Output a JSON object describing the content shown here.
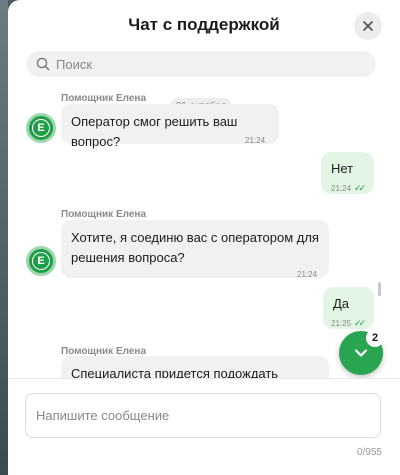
{
  "header": {
    "title": "Чат с поддержкой",
    "close_icon": "close-icon"
  },
  "search": {
    "placeholder": "Поиск",
    "icon": "search-icon"
  },
  "chat": {
    "date_label": "31 октября",
    "messages": [
      {
        "direction": "in",
        "sender": "Помощник Елена",
        "avatar": "Е",
        "lines": [
          "Оператор смог решить ваш вопрос?"
        ],
        "time": "21:24"
      },
      {
        "direction": "out",
        "lines": [
          "Нет"
        ],
        "time": "21:24",
        "status": "read"
      },
      {
        "direction": "in",
        "sender": "Помощник Елена",
        "avatar": "Е",
        "lines": [
          "Хотите, я соединю вас с оператором для",
          "решения вопроса?"
        ],
        "time": "21:24"
      },
      {
        "direction": "out",
        "lines": [
          "Да"
        ],
        "time": "21:25",
        "status": "read"
      },
      {
        "direction": "in",
        "sender": "Помощник Елена",
        "lines": [
          "Специалиста придется подождать примерно"
        ]
      }
    ],
    "unread_count": "2",
    "scroll_down_icon": "chevron-down-icon"
  },
  "composer": {
    "placeholder": "Напишите сообщение",
    "counter": "0/955"
  },
  "colors": {
    "accent": "#29a552",
    "outgoing_bubble": "#e3f6e6",
    "incoming_bubble": "#f1f1f1"
  }
}
